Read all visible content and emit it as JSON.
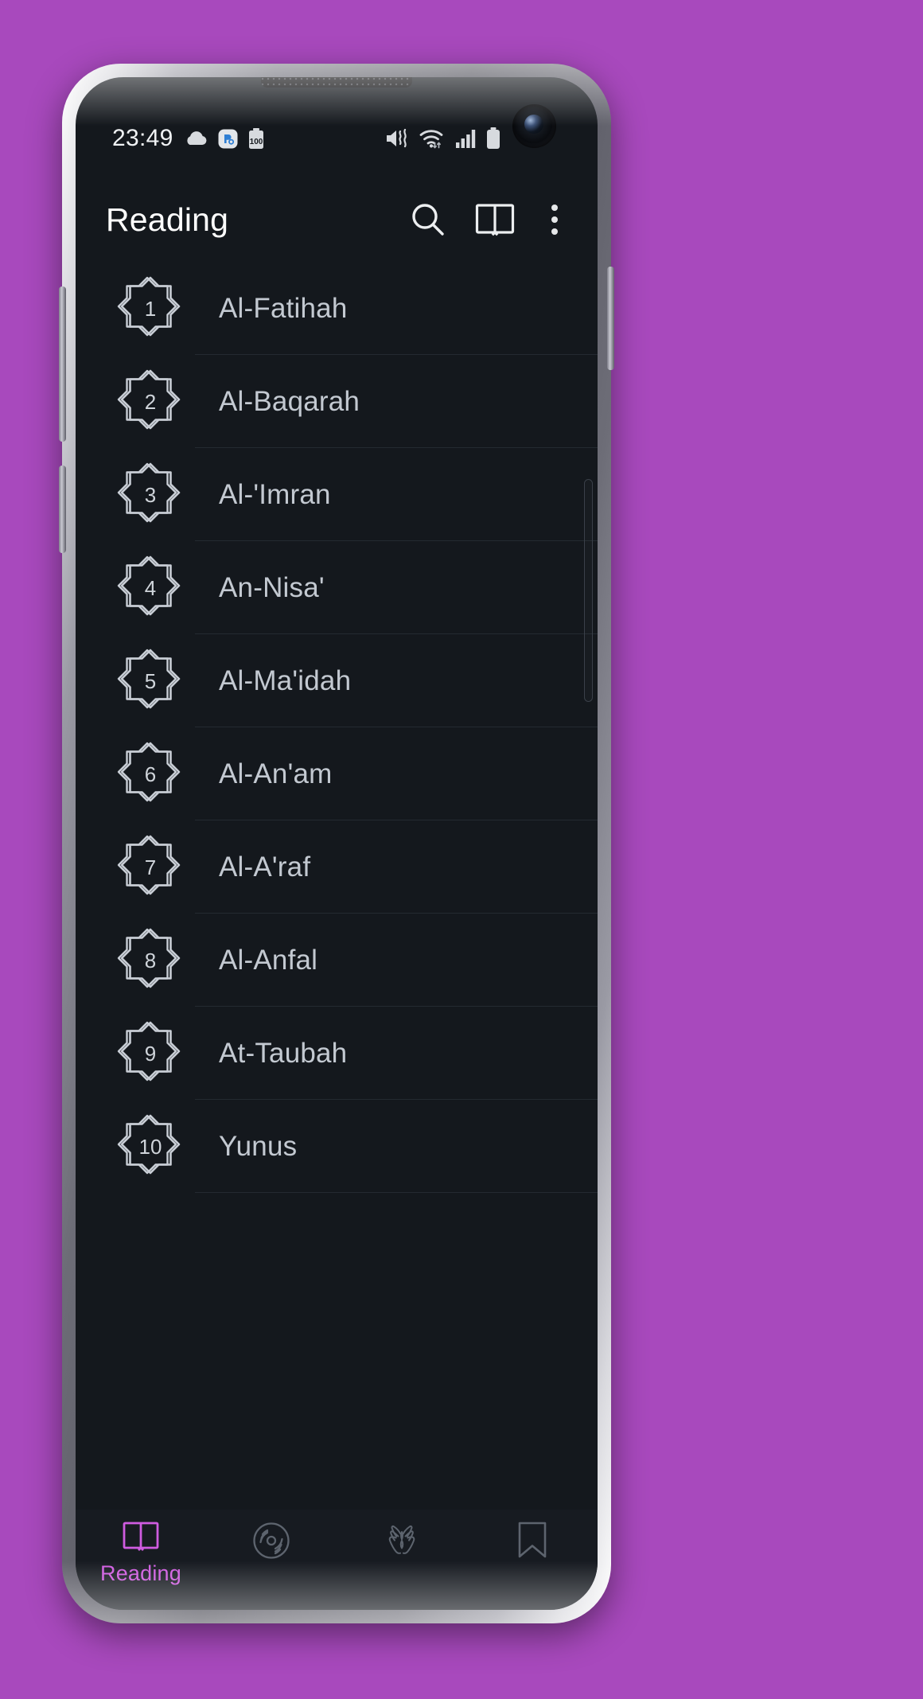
{
  "theme": {
    "wallpaper_color": "#a849bd",
    "screen_bg": "#14181d",
    "accent_color": "#cf5ce0",
    "text_primary": "#ffffff",
    "text_secondary": "#c3c9d1",
    "divider": "#242a31"
  },
  "status_bar": {
    "time": "23:49",
    "left_icons": [
      "cloud-icon",
      "sync-badge-icon",
      "battery-100-icon"
    ],
    "battery_level_label": "100",
    "right_icons": [
      "mute-vibrate-icon",
      "wifi-icon",
      "cellular-signal-icon",
      "battery-icon"
    ]
  },
  "app_bar": {
    "title": "Reading",
    "actions": [
      {
        "name": "search-icon",
        "label": "Search"
      },
      {
        "name": "open-book-icon",
        "label": "Open book"
      },
      {
        "name": "overflow-menu-icon",
        "label": "More options"
      }
    ]
  },
  "list": {
    "items": [
      {
        "number": "1",
        "title": "Al-Fatihah"
      },
      {
        "number": "2",
        "title": "Al-Baqarah"
      },
      {
        "number": "3",
        "title": "Al-'Imran"
      },
      {
        "number": "4",
        "title": "An-Nisa'"
      },
      {
        "number": "5",
        "title": "Al-Ma'idah"
      },
      {
        "number": "6",
        "title": "Al-An'am"
      },
      {
        "number": "7",
        "title": "Al-A'raf"
      },
      {
        "number": "8",
        "title": "Al-Anfal"
      },
      {
        "number": "9",
        "title": "At-Taubah"
      },
      {
        "number": "10",
        "title": "Yunus"
      }
    ]
  },
  "bottom_nav": {
    "items": [
      {
        "name": "nav-reading",
        "label": "Reading",
        "icon": "open-book-icon",
        "active": true
      },
      {
        "name": "nav-audio",
        "label": "",
        "icon": "vinyl-record-icon",
        "active": false
      },
      {
        "name": "nav-dua",
        "label": "",
        "icon": "praying-hands-icon",
        "active": false
      },
      {
        "name": "nav-bookmark",
        "label": "",
        "icon": "bookmark-icon",
        "active": false
      }
    ]
  }
}
